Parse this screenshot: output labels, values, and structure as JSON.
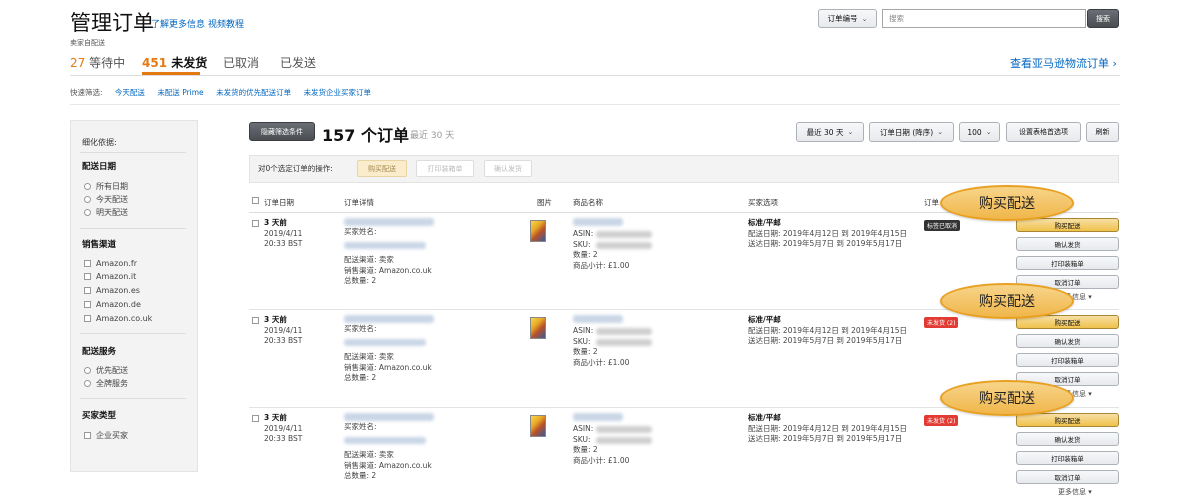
{
  "header": {
    "title": "管理订单",
    "learn_more": "了解更多信息",
    "video": "视频教程",
    "seller_ship": "卖家自配送",
    "search_type": "订单编号",
    "search_placeholder": "搜索",
    "search_button": "搜索",
    "fba_link": "查看亚马逊物流订单 ›"
  },
  "tabs": [
    {
      "count": "27",
      "label": "等待中"
    },
    {
      "count": "451",
      "label": "未发货"
    },
    {
      "count": "",
      "label": "已取消"
    },
    {
      "count": "",
      "label": "已发送"
    }
  ],
  "quick_filter": {
    "label": "快速筛选:",
    "items": [
      "今天配送",
      "未配送 Prime",
      "未发货的优先配送订单",
      "未发货企业买家订单"
    ]
  },
  "sidebar": {
    "title": "细化依据:",
    "ship_date_head": "配送日期",
    "ship_dates": [
      "所有日期",
      "今天配送",
      "明天配送"
    ],
    "channel_head": "销售渠道",
    "channels": [
      "Amazon.fr",
      "Amazon.it",
      "Amazon.es",
      "Amazon.de",
      "Amazon.co.uk"
    ],
    "service_head": "配送服务",
    "services": [
      "优先配送",
      "全牌服务"
    ],
    "buyer_head": "买家类型",
    "buyers": [
      "企业买家"
    ]
  },
  "toolbar": {
    "hide_filters": "隐藏筛选条件",
    "count_title": "157 个订单",
    "count_sub": "最近 30 天",
    "range_select": "最近 30 天",
    "sort_select": "订单日期 (降序)",
    "per_page": "100",
    "prefs": "设置表格首选项",
    "refresh": "刷新"
  },
  "bulk": {
    "label": "对0个选定订单的操作:",
    "buy_ship": "购买配送",
    "print_slip": "打印装箱单",
    "confirm_ship": "确认发货"
  },
  "columns": [
    "订单日期",
    "订单详情",
    "图片",
    "商品名称",
    "买家选项",
    "订单"
  ],
  "orders": [
    {
      "age": "3 天前",
      "date": "2019/4/11",
      "time": "20:33 BST",
      "buyer_label": "买家姓名:",
      "channel_type": "配送渠道: 卖家",
      "channel": "销售渠道: Amazon.co.uk",
      "total_qty": "总数量: 2",
      "asin_label": "ASIN:",
      "sku_label": "SKU:",
      "qty": "数量: 2",
      "subtotal": "商品小计: £1.00",
      "ship_level": "标准/平邮",
      "ship_date": "配送日期: 2019年4月12日 到 2019年4月15日",
      "delivery_date": "送达日期: 2019年5月7日 到 2019年5月17日",
      "status": "标签已取消",
      "status_color": "#333333"
    },
    {
      "age": "3 天前",
      "date": "2019/4/11",
      "time": "20:33 BST",
      "buyer_label": "买家姓名:",
      "channel_type": "配送渠道: 卖家",
      "channel": "销售渠道: Amazon.co.uk",
      "total_qty": "总数量: 2",
      "asin_label": "ASIN:",
      "sku_label": "SKU:",
      "qty": "数量: 2",
      "subtotal": "商品小计: £1.00",
      "ship_level": "标准/平邮",
      "ship_date": "配送日期: 2019年4月12日 到 2019年4月15日",
      "delivery_date": "送达日期: 2019年5月7日 到 2019年5月17日",
      "status": "未发货 (2)",
      "status_color": "#e23b33"
    },
    {
      "age": "3 天前",
      "date": "2019/4/11",
      "time": "20:33 BST",
      "buyer_label": "买家姓名:",
      "channel_type": "配送渠道: 卖家",
      "channel": "销售渠道: Amazon.co.uk",
      "total_qty": "总数量: 2",
      "asin_label": "ASIN:",
      "sku_label": "SKU:",
      "qty": "数量: 2",
      "subtotal": "商品小计: £1.00",
      "ship_level": "标准/平邮",
      "ship_date": "配送日期: 2019年4月12日 到 2019年4月15日",
      "delivery_date": "送达日期: 2019年5月7日 到 2019年5月17日",
      "status": "未发货 (2)",
      "status_color": "#e23b33"
    }
  ],
  "actions": {
    "buy_ship": "购买配送",
    "confirm_ship": "确认发货",
    "print_slip": "打印装箱单",
    "cancel": "取消订单",
    "more": "更多信息"
  },
  "callout": {
    "label": "购买配送",
    "fill": "#f0b64a",
    "border": "#e8a020"
  },
  "colors": {
    "accent": "#e47911",
    "link": "#0066c0"
  }
}
